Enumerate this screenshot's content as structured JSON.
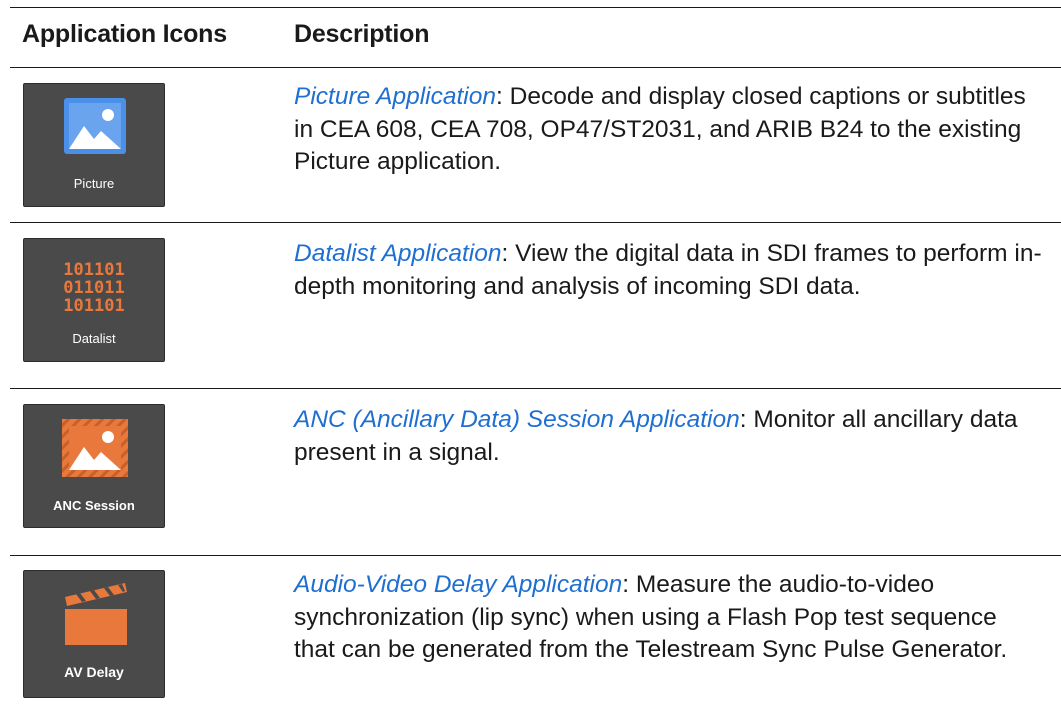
{
  "header": {
    "col1": "Application Icons",
    "col2": "Description"
  },
  "rows": [
    {
      "icon": "picture-app-icon",
      "icon_label": "Picture",
      "link_text": "Picture Application",
      "description": ": Decode and display closed captions or subtitles in CEA 608, CEA 708, OP47/ST2031, and ARIB B24 to the existing Picture application."
    },
    {
      "icon": "datalist-app-icon",
      "icon_label": "Datalist",
      "binary_lines": [
        "101101",
        "011011",
        "101101"
      ],
      "link_text": "Datalist Application",
      "description": ": View the digital data in SDI frames to perform in-depth monitoring and analysis of incoming SDI data."
    },
    {
      "icon": "anc-session-app-icon",
      "icon_label": "ANC Session",
      "link_text": "ANC (Ancillary Data) Session Application",
      "description": ": Monitor all ancillary data present in a signal."
    },
    {
      "icon": "av-delay-app-icon",
      "icon_label": "AV Delay",
      "link_text": "Audio-Video Delay Application",
      "description": ": Measure the audio-to-video synchronization (lip sync) when using a Flash Pop test sequence that can be generated from the Telestream Sync Pulse Generator."
    }
  ],
  "colors": {
    "link": "#1f6fd1",
    "icon_bg": "#4a4a4a",
    "picture_blue": "#4a8fe8",
    "accent_orange": "#e8783c"
  }
}
